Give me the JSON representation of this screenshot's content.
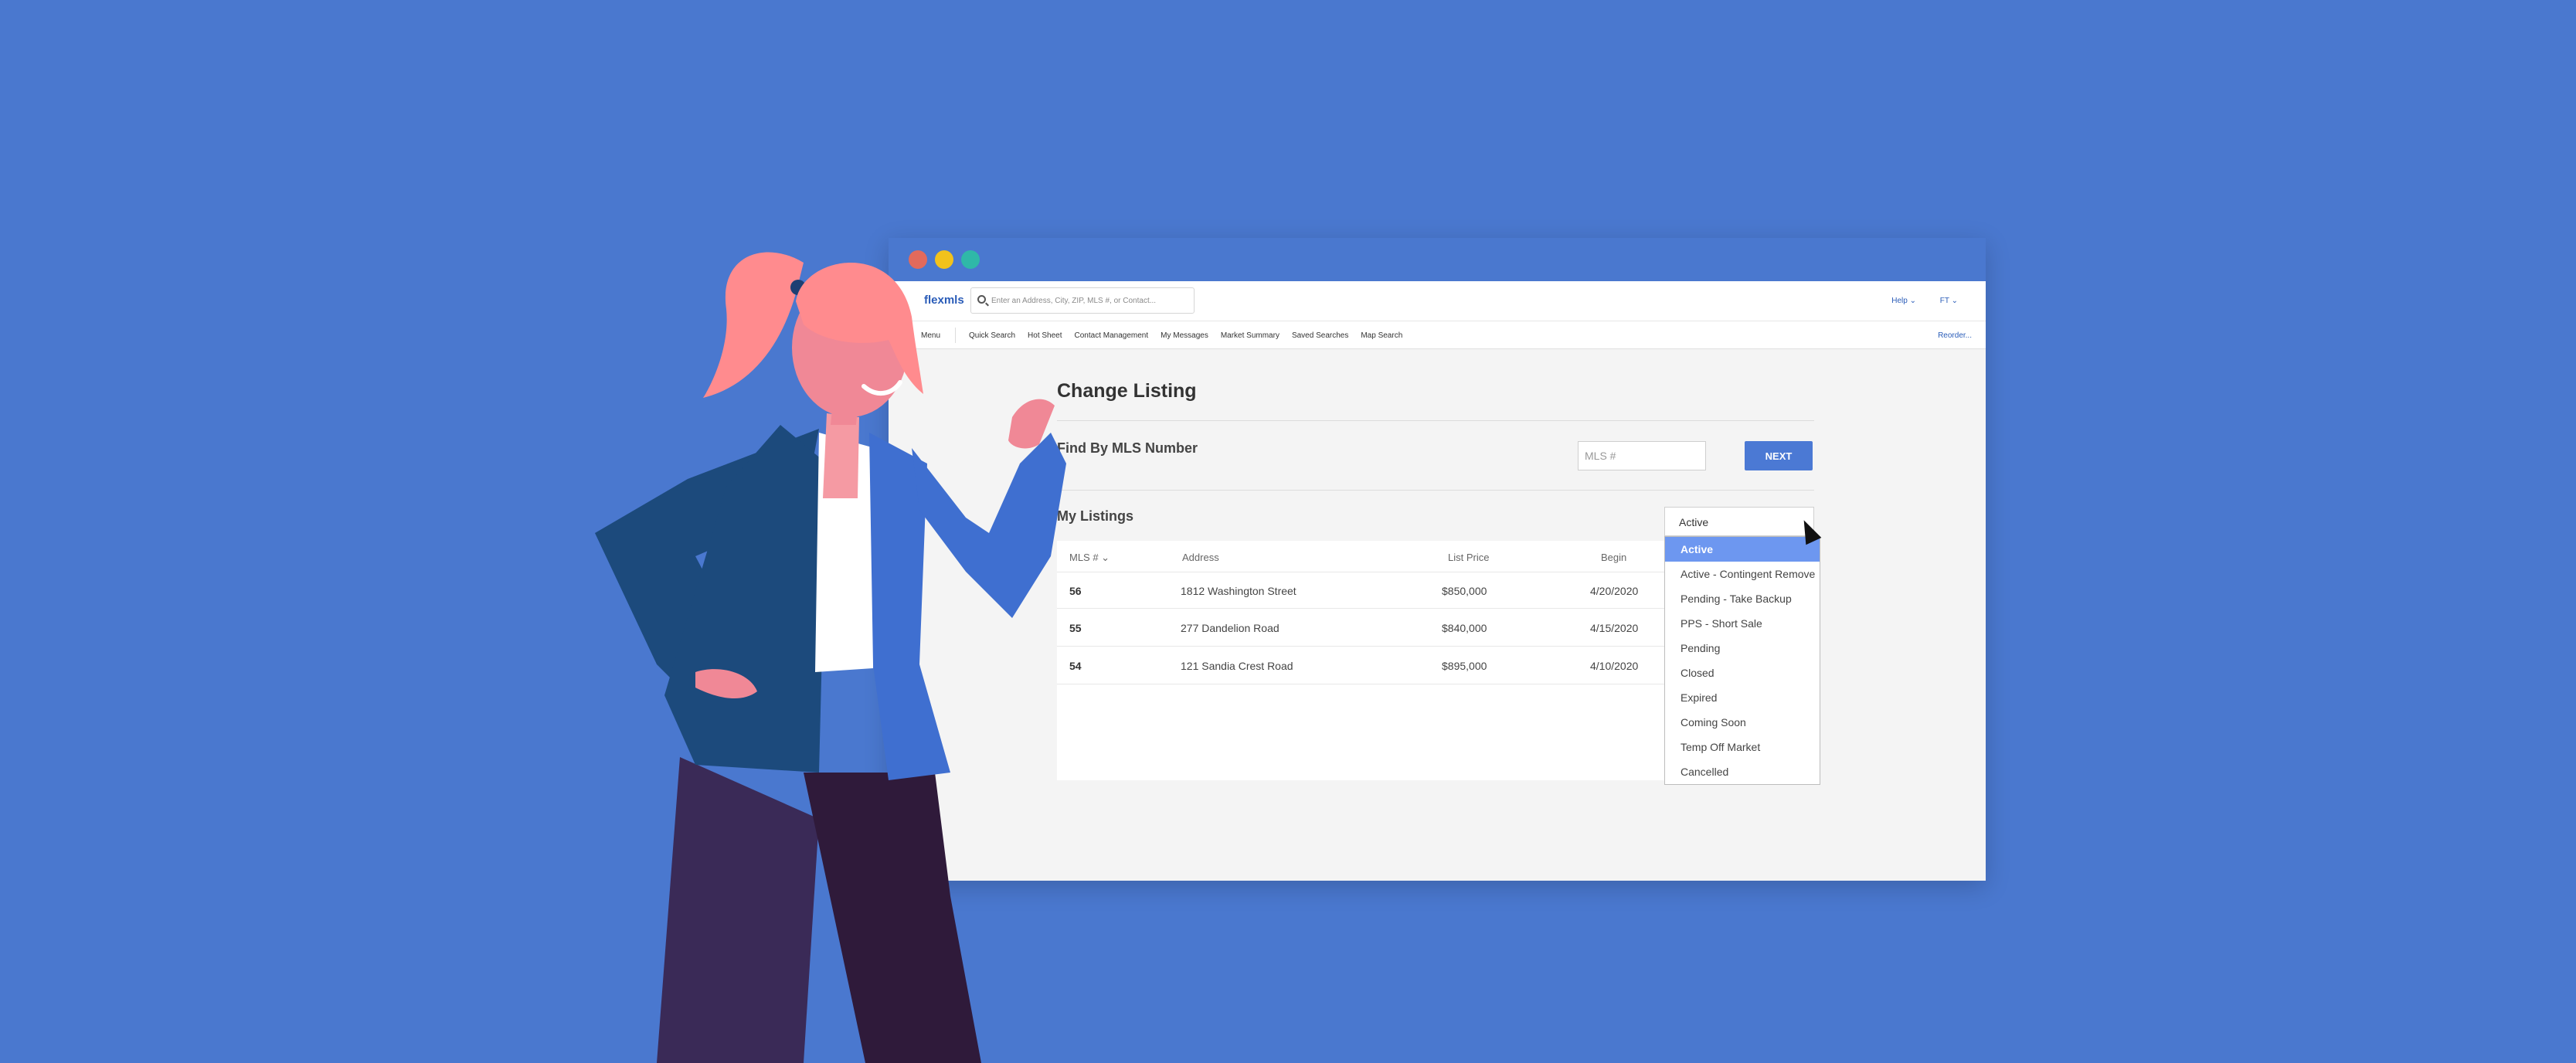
{
  "app": {
    "logo": "flexmls",
    "search_placeholder": "Enter an Address, City, ZIP, MLS #, or Contact...",
    "help_label": "Help ⌄",
    "user_label": "FT ⌄"
  },
  "nav": {
    "menu_label": "Menu",
    "items": [
      "Quick Search",
      "Hot Sheet",
      "Contact Management",
      "My Messages",
      "Market Summary",
      "Saved Searches",
      "Map Search"
    ],
    "right_label": "Reorder..."
  },
  "page": {
    "title": "Change Listing",
    "find_label": "Find By MLS Number",
    "mls_placeholder": "MLS #",
    "next_label": "NEXT",
    "my_listings_label": "My Listings"
  },
  "table": {
    "headers": {
      "mls": "MLS # ⌄",
      "address": "Address",
      "list_price": "List Price",
      "begin": "Begin"
    },
    "rows": [
      {
        "mls": "56",
        "address": "1812 Washington Street",
        "price": "$850,000",
        "begin": "4/20/2020"
      },
      {
        "mls": "55",
        "address": "277 Dandelion Road",
        "price": "$840,000",
        "begin": "4/15/2020"
      },
      {
        "mls": "54",
        "address": "121 Sandia Crest Road",
        "price": "$895,000",
        "begin": "4/10/2020"
      }
    ]
  },
  "status": {
    "selected": "Active",
    "options": [
      "Active",
      "Active - Contingent Remove",
      "Pending - Take Backup",
      "PPS - Short Sale",
      "Pending",
      "Closed",
      "Expired",
      "Coming Soon",
      "Temp Off Market",
      "Cancelled"
    ]
  },
  "colors": {
    "background": "#4a78cf",
    "accent": "#4b79d4",
    "selected_option": "#6d97f0"
  }
}
